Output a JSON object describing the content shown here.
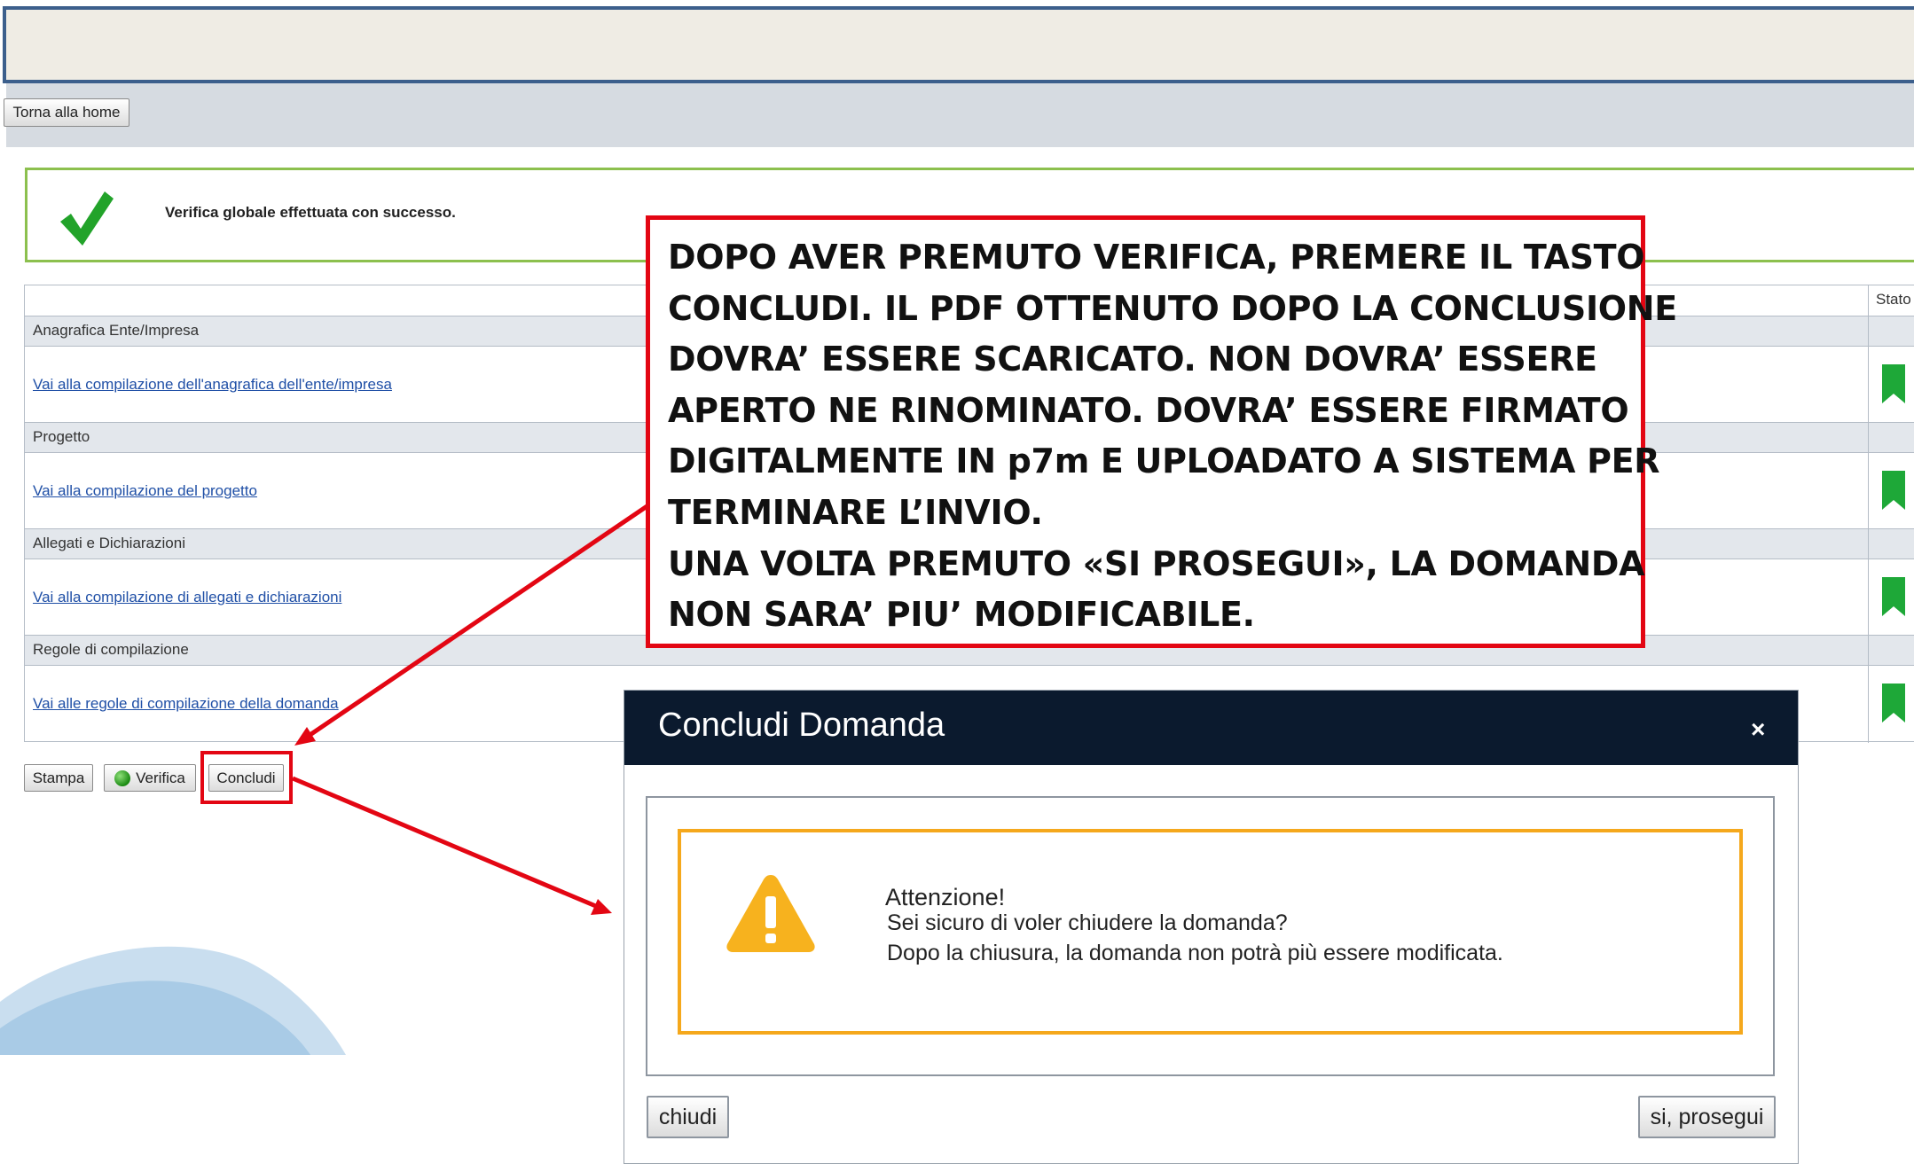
{
  "header": {
    "home_button": "Torna alla home"
  },
  "success_message": "Verifica globale effettuata con successo.",
  "table": {
    "status_header": "Stato",
    "sections": [
      {
        "header": "Anagrafica Ente/Impresa",
        "link": "Vai alla compilazione dell'anagrafica dell'ente/impresa",
        "status": "complete"
      },
      {
        "header": "Progetto",
        "link": "Vai alla compilazione del progetto",
        "status": "complete"
      },
      {
        "header": "Allegati e Dichiarazioni",
        "link": "Vai alla compilazione di allegati e dichiarazioni",
        "status": "complete"
      },
      {
        "header": "Regole di compilazione",
        "link": "Vai alle regole di compilazione della domanda",
        "status": "complete"
      }
    ]
  },
  "actions": {
    "stampa": "Stampa",
    "verifica": "Verifica",
    "concludi": "Concludi"
  },
  "callout": {
    "lines": [
      "DOPO AVER PREMUTO VERIFICA, PREMERE IL TASTO",
      "CONCLUDI. IL PDF OTTENUTO DOPO LA CONCLUSIONE",
      "DOVRA’ ESSERE SCARICATO. NON DOVRA’ ESSERE",
      "APERTO NE RINOMINATO. DOVRA’ ESSERE FIRMATO",
      "DIGITALMENTE IN p7m E UPLOADATO A SISTEMA PER",
      "TERMINARE L’INVIO.",
      "UNA VOLTA PREMUTO «SI PROSEGUI», LA DOMANDA",
      "NON SARA’ PIU’ MODIFICABILE."
    ]
  },
  "modal": {
    "title": "Concludi Domanda",
    "close_symbol": "×",
    "warning_title": "Attenzione!",
    "warning_line1": "Sei sicuro di voler chiudere la domanda?",
    "warning_line2": "Dopo la chiusura, la domanda non potrà più essere modificata.",
    "cancel_button": "chiudi",
    "confirm_button": "si, prosegui"
  },
  "colors": {
    "annotation_red": "#e30613",
    "success_green": "#8cc04e",
    "bookmark_green": "#1ea838",
    "warning_orange": "#f5a81c",
    "modal_header": "#0b1a2e"
  },
  "icons": [
    "check-icon",
    "bookmark-icon",
    "green-dot-icon",
    "warning-icon",
    "close-icon",
    "arrow-icon"
  ]
}
